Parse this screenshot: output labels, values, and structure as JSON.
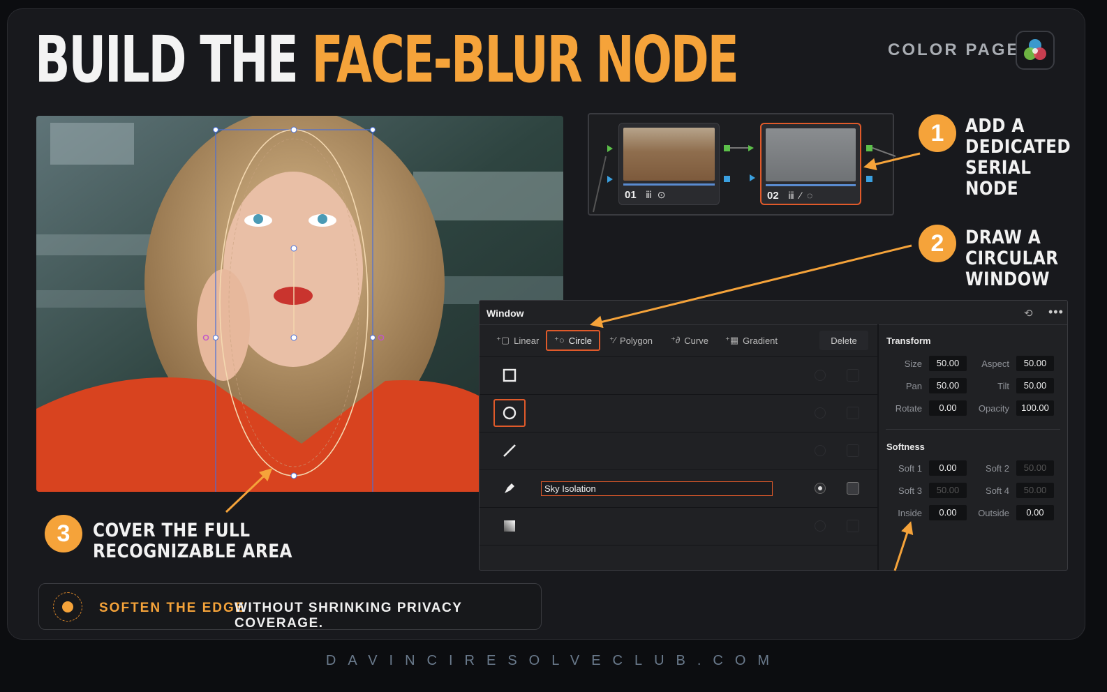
{
  "title": {
    "white": "BUILD THE ",
    "orange": "FACE-BLUR NODE"
  },
  "page_label": "COLOR PAGE",
  "nodes": [
    {
      "num": "01",
      "icons": "ⅲ ⊙"
    },
    {
      "num": "02",
      "icons": "ⅲ ⁄ ◌"
    }
  ],
  "steps": [
    {
      "num": "1",
      "text": "ADD A\nDEDICATED\nSERIAL NODE"
    },
    {
      "num": "2",
      "text": "DRAW A\nCIRCULAR\nWINDOW"
    },
    {
      "num": "3",
      "text": "COVER THE FULL\nRECOGNIZABLE AREA"
    }
  ],
  "window_panel": {
    "title": "Window",
    "tools": [
      "Linear",
      "Circle",
      "Polygon",
      "Curve",
      "Gradient"
    ],
    "delete_label": "Delete",
    "row_name": "Sky Isolation",
    "transform": {
      "title": "Transform",
      "size_label": "Size",
      "size": "50.00",
      "aspect_label": "Aspect",
      "aspect": "50.00",
      "pan_label": "Pan",
      "pan": "50.00",
      "tilt_label": "Tilt",
      "tilt": "50.00",
      "rotate_label": "Rotate",
      "rotate": "0.00",
      "opacity_label": "Opacity",
      "opacity": "100.00"
    },
    "softness": {
      "title": "Softness",
      "soft1_label": "Soft 1",
      "soft1": "0.00",
      "soft2_label": "Soft 2",
      "soft2": "50.00",
      "soft3_label": "Soft 3",
      "soft3": "50.00",
      "soft4_label": "Soft 4",
      "soft4": "50.00",
      "inside_label": "Inside",
      "inside": "0.00",
      "outside_label": "Outside",
      "outside": "0.00"
    }
  },
  "soften": {
    "highlight": "SOFTEN THE EDGE",
    "rest": "WITHOUT SHRINKING PRIVACY COVERAGE."
  },
  "footer": "DAVINCIRESOLVECLUB.COM",
  "colors": {
    "accent": "#f5a33a",
    "selection": "#e05a2a"
  }
}
